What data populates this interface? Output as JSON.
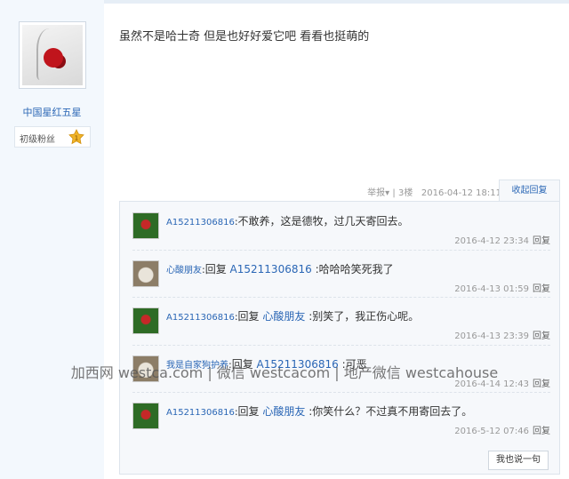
{
  "user": {
    "name": "中国星红五星",
    "rank": "初级粉丝",
    "level": "1"
  },
  "post": {
    "content": "虽然不是哈士奇 但是也好好爱它吧 看看也挺萌的",
    "report": "举报",
    "floor": "3楼",
    "time": "2016-04-12 18:11",
    "collapse": "收起回复"
  },
  "replies": [
    {
      "author": "A15211306816",
      "colon": ":",
      "reply_word": "",
      "reply_to": "",
      "text": "不敢养，这是德牧，过几天寄回去。",
      "time": "2016-4-12 23:34",
      "action": "回复",
      "avatar": "rose"
    },
    {
      "author": "心酸朋友",
      "colon": ":",
      "reply_word": "回复 ",
      "reply_to": "A15211306816",
      "text": " :哈哈哈笑死我了",
      "time": "2016-4-13 01:59",
      "action": "回复",
      "avatar": "cat"
    },
    {
      "author": "A15211306816",
      "colon": ":",
      "reply_word": "回复 ",
      "reply_to": "心酸朋友",
      "text": " :别笑了，我正伤心呢。",
      "time": "2016-4-13 23:39",
      "action": "回复",
      "avatar": "rose"
    },
    {
      "author": "我是自家狗护养",
      "colon": ":",
      "reply_word": "回复 ",
      "reply_to": "A15211306816",
      "text": " :可恶",
      "time": "2016-4-14 12:43",
      "action": "回复",
      "avatar": "cat"
    },
    {
      "author": "A15211306816",
      "colon": ":",
      "reply_word": "回复 ",
      "reply_to": "心酸朋友",
      "text": " :你笑什么？不过真不用寄回去了。",
      "time": "2016-5-12 07:46",
      "action": "回复",
      "avatar": "rose"
    }
  ],
  "say_button": "我也说一句",
  "watermark": "加西网 westca.com | 微信 westcacom | 地产微信 westcahouse"
}
